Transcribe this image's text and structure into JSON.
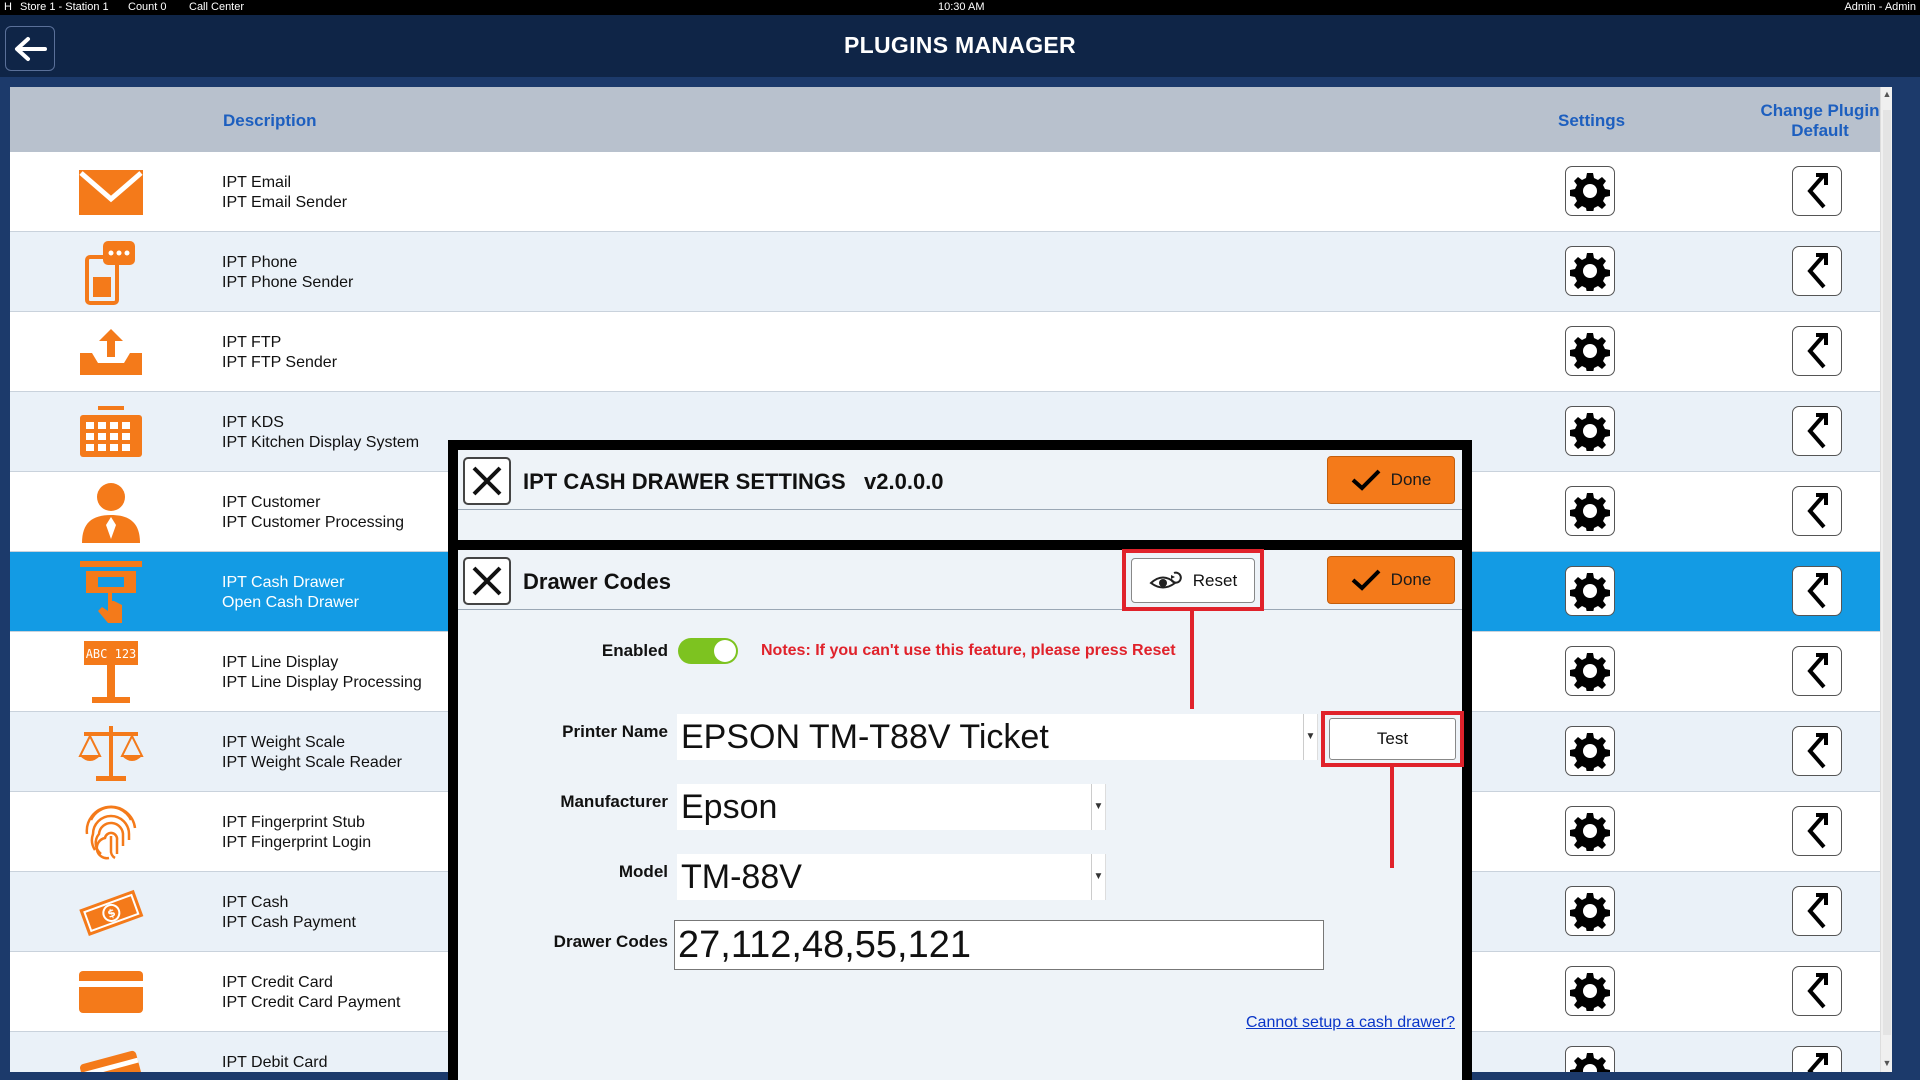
{
  "status_bar": {
    "left_items": [
      "H",
      "Store 1 - Station 1",
      "Count 0",
      "Call Center"
    ],
    "time": "10:30 AM",
    "user": "Admin - Admin"
  },
  "header": {
    "title": "PLUGINS MANAGER"
  },
  "table": {
    "headers": {
      "description": "Description",
      "settings": "Settings",
      "change_default": "Change Plugin Default"
    },
    "rows": [
      {
        "name": "IPT Email",
        "desc": "IPT Email Sender",
        "icon": "envelope-icon"
      },
      {
        "name": "IPT Phone",
        "desc": "IPT Phone Sender",
        "icon": "phone-icon"
      },
      {
        "name": "IPT FTP",
        "desc": "IPT FTP Sender",
        "icon": "upload-tray-icon"
      },
      {
        "name": "IPT KDS",
        "desc": "IPT Kitchen Display System",
        "icon": "keyboard-icon"
      },
      {
        "name": "IPT Customer",
        "desc": "IPT Customer Processing",
        "icon": "person-icon"
      },
      {
        "name": "IPT Cash Drawer",
        "desc": "Open Cash Drawer",
        "icon": "cash-drawer-icon",
        "selected": true
      },
      {
        "name": "IPT Line Display",
        "desc": "IPT Line Display Processing",
        "icon": "line-display-icon"
      },
      {
        "name": "IPT Weight Scale",
        "desc": "IPT Weight Scale Reader",
        "icon": "scale-icon"
      },
      {
        "name": "IPT Fingerprint Stub",
        "desc": "IPT Fingerprint Login",
        "icon": "fingerprint-icon"
      },
      {
        "name": "IPT Cash",
        "desc": "IPT Cash Payment",
        "icon": "cash-icon"
      },
      {
        "name": "IPT Credit Card",
        "desc": "IPT Credit Card Payment",
        "icon": "credit-card-icon"
      },
      {
        "name": "IPT Debit Card",
        "desc": "",
        "icon": "debit-card-icon"
      }
    ]
  },
  "dialog": {
    "title": "IPT CASH DRAWER SETTINGS",
    "version": "v2.0.0.0",
    "done_label": "Done",
    "section_title": "Drawer Codes",
    "reset_label": "Reset",
    "section_done_label": "Done",
    "enabled_label": "Enabled",
    "enabled": true,
    "notes": "Notes: If you can't use this feature, please press Reset",
    "printer_label": "Printer Name",
    "printer_value": "EPSON TM-T88V Ticket",
    "test_label": "Test",
    "manufacturer_label": "Manufacturer",
    "manufacturer_value": "Epson",
    "model_label": "Model",
    "model_value": "TM-88V",
    "codes_label": "Drawer Codes",
    "codes_value": "27,112,48,55,121",
    "help_link": "Cannot setup a cash drawer?"
  },
  "colors": {
    "accent_orange": "#f47a1a",
    "selected_row": "#139be4",
    "highlight_red": "#e0222b",
    "header_bg": "#0f2547"
  }
}
